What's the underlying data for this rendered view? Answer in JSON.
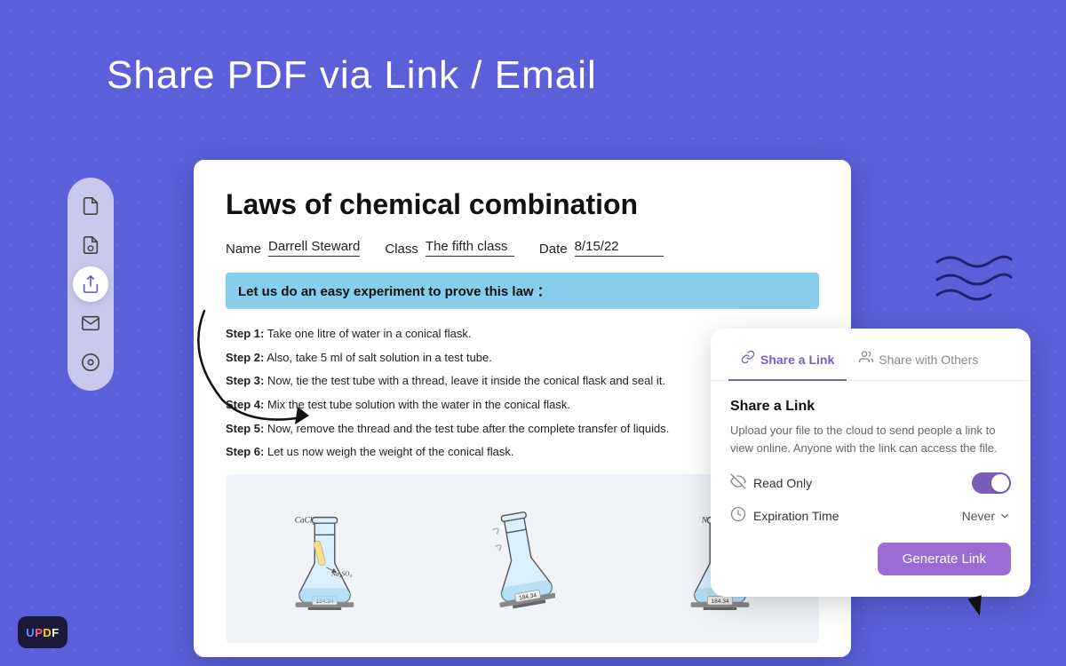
{
  "header": {
    "title": "Share PDF via Link / Email"
  },
  "sidebar": {
    "buttons": [
      {
        "id": "file-icon",
        "icon": "📄",
        "active": false
      },
      {
        "id": "lock-file-icon",
        "icon": "🔒",
        "active": false
      },
      {
        "id": "share-icon",
        "icon": "⬆",
        "active": true
      },
      {
        "id": "email-icon",
        "icon": "✉",
        "active": false
      },
      {
        "id": "save-icon",
        "icon": "💾",
        "active": false
      }
    ]
  },
  "pdf": {
    "title": "Laws of chemical combination",
    "fields": {
      "name_label": "Name",
      "name_value": "Darrell Steward",
      "class_label": "Class",
      "class_value": "The fifth class",
      "date_label": "Date",
      "date_value": "8/15/22"
    },
    "highlight_text": "Let us do an easy experiment to prove this law ：",
    "steps": [
      {
        "label": "Step 1:",
        "text": "Take one litre of water in a conical flask."
      },
      {
        "label": "Step 2:",
        "text": "Also, take 5 ml of salt solution in a test tube."
      },
      {
        "label": "Step 3:",
        "text": "Now, tie the test tube with a thread, leave it inside the conical flask and seal it."
      },
      {
        "label": "Step 4:",
        "text": "Mix the test tube solution with the water in the conical flask."
      },
      {
        "label": "Step 5:",
        "text": "Now, remove the thread and the test tube after the complete transfer of liquids."
      },
      {
        "label": "Step 6:",
        "text": "Let us now weigh the weight of the conical flask."
      }
    ]
  },
  "share_panel": {
    "tabs": [
      {
        "id": "share-link-tab",
        "label": "Share a Link",
        "active": true,
        "icon": "🔗"
      },
      {
        "id": "share-others-tab",
        "label": "Share with Others",
        "active": false,
        "icon": "👥"
      }
    ],
    "title": "Share a Link",
    "description": "Upload your file to the cloud to send people a link to view online. Anyone with the link can access the file.",
    "read_only_label": "Read Only",
    "read_only_enabled": true,
    "expiry_label": "Expiration Time",
    "expiry_value": "Never",
    "generate_btn_label": "Generate Link"
  },
  "updf_logo": "UPDF"
}
